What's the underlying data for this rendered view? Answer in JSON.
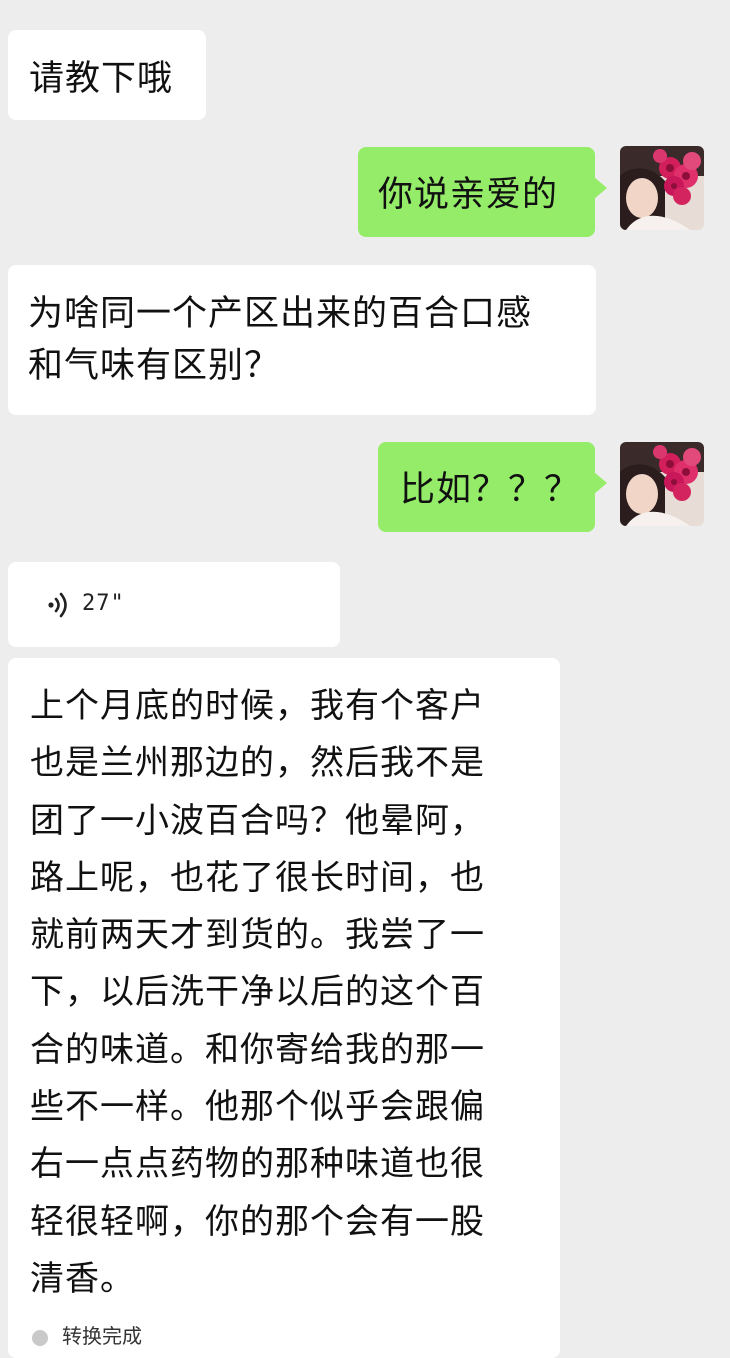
{
  "messages": {
    "m1": {
      "sender": "other",
      "text": "请教下哦"
    },
    "m2": {
      "sender": "self",
      "text": "你说亲爱的"
    },
    "m3": {
      "sender": "other",
      "text": "为啥同一个产区出来的百合口感\n和气味有区别？"
    },
    "m4": {
      "sender": "self",
      "text": "比如？？？"
    },
    "m5": {
      "sender": "other",
      "type": "voice",
      "duration": "27\""
    },
    "m6": {
      "sender": "other",
      "text": "上个月底的时候，我有个客户\n也是兰州那边的，然后我不是\n团了一小波百合吗？他晕阿，\n路上呢，也花了很长时间，也\n就前两天才到货的。我尝了一\n下，以后洗干净以后的这个百\n合的味道。和你寄给我的那一\n些不一样。他那个似乎会跟偏\n右一点点药物的那种味道也很\n轻很轻啊，你的那个会有一股\n清香。"
    }
  },
  "transcription_status": "转换完成",
  "colors": {
    "background": "#ededed",
    "self_bubble": "#95ec69",
    "other_bubble": "#ffffff"
  },
  "icons": {
    "voice": "voice-wave-icon",
    "avatar": "avatar-pink-roses"
  }
}
